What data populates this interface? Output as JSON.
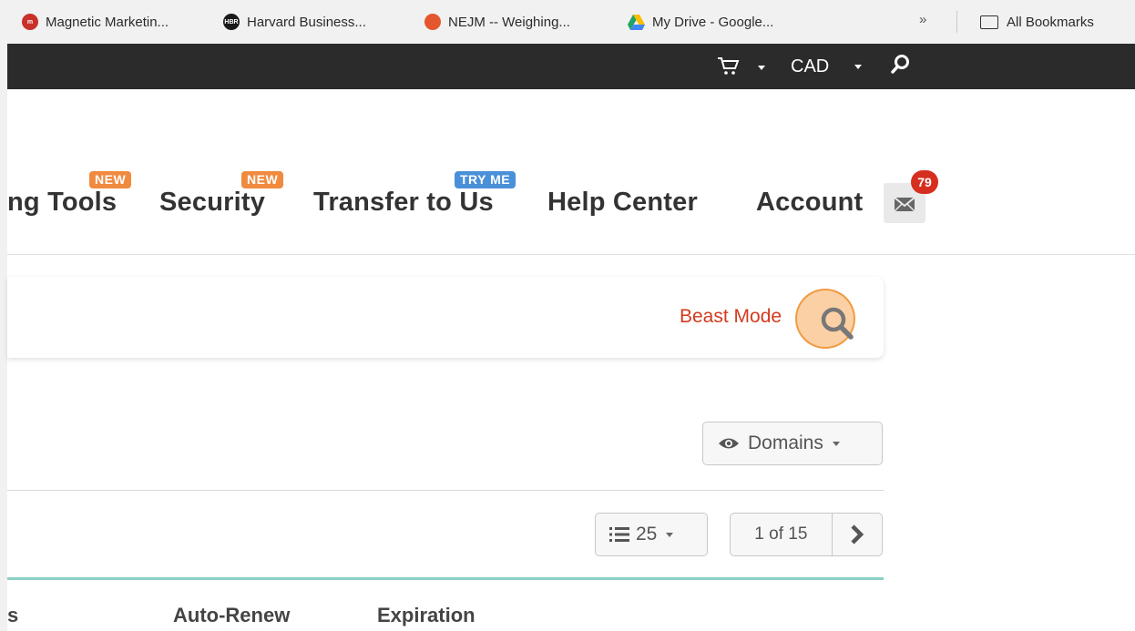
{
  "bookmarks": {
    "items": [
      {
        "label": "Magnetic Marketin...",
        "icon": "magnetic-marketing-favicon",
        "color": "#c8302a"
      },
      {
        "label": "Harvard Business...",
        "icon": "hbr-favicon",
        "color": "#1a1a1a"
      },
      {
        "label": "NEJM -- Weighing...",
        "icon": "nejm-favicon",
        "color": "#e4572e"
      },
      {
        "label": "My Drive - Google...",
        "icon": "google-drive-favicon",
        "color": "#1fa463"
      }
    ],
    "more": "»",
    "all_bookmarks": "All Bookmarks"
  },
  "topbar": {
    "currency": "CAD",
    "cart_icon": "cart-icon",
    "search_icon": "search-icon"
  },
  "nav": {
    "items": [
      {
        "label": "ng Tools",
        "badge": "NEW",
        "badge_color": "#f08a3e"
      },
      {
        "label": "Security",
        "badge": "NEW",
        "badge_color": "#f08a3e"
      },
      {
        "label": "Transfer to Us",
        "badge": "TRY ME",
        "badge_color": "#4a90d9"
      },
      {
        "label": "Help Center"
      },
      {
        "label": "Account"
      }
    ],
    "notifications": "79",
    "notification_color": "#d62e1f"
  },
  "search": {
    "beast_mode": "Beast Mode"
  },
  "domains_dropdown": {
    "label": "Domains"
  },
  "pagination": {
    "per_page": "25",
    "page": "1 of 15"
  },
  "table": {
    "columns": [
      "s",
      "Auto-Renew",
      "Expiration"
    ]
  }
}
